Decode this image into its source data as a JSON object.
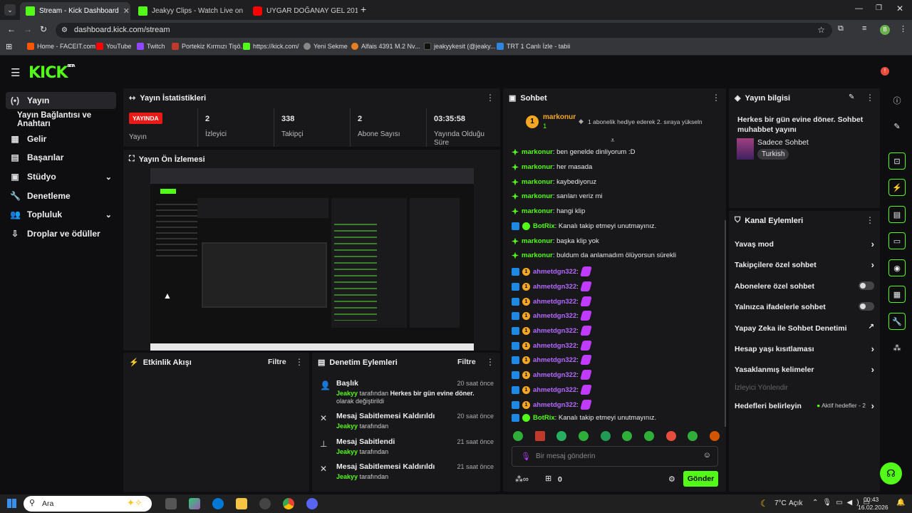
{
  "browser": {
    "tabs": [
      {
        "label": "Stream - Kick Dashboard",
        "color": "#53fc18"
      },
      {
        "label": "Jeakyy Clips - Watch Live on Kic",
        "color": "#53fc18"
      },
      {
        "label": "UYGAR DOĞANAY GEL 201",
        "color": "#ff0000"
      }
    ],
    "new_tab": "+",
    "url": "dashboard.kick.com/stream",
    "bookmarks": [
      "Home - FACEIT.com",
      "YouTube",
      "Twitch",
      "Portekiz Kırmızı Tişö...",
      "https://kick.com/",
      "Yeni Sekme",
      "Alfais 4391 M.2 Nv...",
      "jeakyykesit (@jeaky...",
      "TRT 1 Canlı İzle - tabii"
    ],
    "profile": "B"
  },
  "app": {
    "logo": "KICK",
    "logo_sup": "BETA",
    "accent": "#53fc18"
  },
  "sidebar": {
    "items": [
      {
        "label": "Yayın",
        "icon": "(•)"
      },
      {
        "label": "Yayın Bağlantısı ve Anahtarı",
        "icon": ""
      },
      {
        "label": "Gelir",
        "icon": "▦"
      },
      {
        "label": "Başarılar",
        "icon": "▤"
      },
      {
        "label": "Stüdyo",
        "icon": "▣"
      },
      {
        "label": "Denetleme",
        "icon": "🔧"
      },
      {
        "label": "Topluluk",
        "icon": "👥"
      },
      {
        "label": "Droplar ve ödüller",
        "icon": "⇩"
      }
    ]
  },
  "stats": {
    "title": "Yayın İstatistikleri",
    "live_badge": "YAYINDA",
    "live_label": "Yayın",
    "items": [
      {
        "value": "2",
        "label": "İzleyici"
      },
      {
        "value": "338",
        "label": "Takipçi"
      },
      {
        "value": "2",
        "label": "Abone Sayısı"
      },
      {
        "value": "03:35:58",
        "label": "Yayında Olduğu Süre"
      }
    ]
  },
  "preview": {
    "title": "Yayın Ön İzlemesi"
  },
  "activity": {
    "title": "Etkinlik Akışı",
    "filter": "Filtre"
  },
  "moderation": {
    "title": "Denetim Eylemleri",
    "filter": "Filtre",
    "items": [
      {
        "title": "Başlık",
        "time": "20 saat önce",
        "user": "Jeakyy",
        "by": "tarafından",
        "bold": "Herkes bir gün evine döner.",
        "rest": "olarak değiştirildi"
      },
      {
        "title": "Mesaj Sabitlemesi Kaldırıldı",
        "time": "20 saat önce",
        "user": "Jeakyy",
        "by": "tarafından"
      },
      {
        "title": "Mesaj Sabitlendi",
        "time": "21 saat önce",
        "user": "Jeakyy",
        "by": "tarafından"
      },
      {
        "title": "Mesaj Sabitlemesi Kaldırıldı",
        "time": "21 saat önce",
        "user": "Jeakyy",
        "by": "tarafından"
      }
    ]
  },
  "chat": {
    "title": "Sohbet",
    "pinned_user": "markonur",
    "pinned_count": "1",
    "pinned_rank": "1",
    "pinned_msg": "1 abonelik hediye ederek 2. sıraya yükseln",
    "messages": [
      {
        "user": "markonur",
        "text": ": ben genelde dinliyorum :D",
        "type": "mk"
      },
      {
        "user": "markonur",
        "text": ": her masada",
        "type": "mk"
      },
      {
        "user": "markonur",
        "text": ": kaybediyoruz",
        "type": "mk"
      },
      {
        "user": "markonur",
        "text": ": sarıları veriz mi",
        "type": "mk"
      },
      {
        "user": "markonur",
        "text": ": hangi klip",
        "type": "mk"
      },
      {
        "user": "BotRix",
        "text": ": Kanalı takip etmeyi unutmayınız.",
        "type": "bot"
      },
      {
        "user": "markonur",
        "text": ": başka klip yok",
        "type": "mk"
      },
      {
        "user": "markonur",
        "text": ": buldum da anlamadım ölüyorsun sürekli",
        "type": "mk"
      },
      {
        "user": "ahmetdgn322",
        "text": ":",
        "type": "ah"
      },
      {
        "user": "ahmetdgn322",
        "text": ":",
        "type": "ah"
      },
      {
        "user": "ahmetdgn322",
        "text": ":",
        "type": "ah"
      },
      {
        "user": "ahmetdgn322",
        "text": ":",
        "type": "ah"
      },
      {
        "user": "ahmetdgn322",
        "text": ":",
        "type": "ah"
      },
      {
        "user": "ahmetdgn322",
        "text": ":",
        "type": "ah"
      },
      {
        "user": "ahmetdgn322",
        "text": ":",
        "type": "ah"
      },
      {
        "user": "ahmetdgn322",
        "text": ":",
        "type": "ah"
      },
      {
        "user": "ahmetdgn322",
        "text": ":",
        "type": "ah"
      },
      {
        "user": "ahmetdgn322",
        "text": ":",
        "type": "ah"
      },
      {
        "user": "BotRix",
        "text": ": Kanalı takip etmeyi unutmayınız.",
        "type": "bot"
      }
    ],
    "placeholder": "Bir mesaj gönderin",
    "points": "0",
    "send": "Gönder"
  },
  "info": {
    "title": "Yayın bilgisi",
    "stream_title": "Herkes bir gün evine döner. Sohbet muhabbet yayını",
    "category": "Sadece Sohbet",
    "tag": "Turkish"
  },
  "channel": {
    "title": "Kanal Eylemleri",
    "items": [
      {
        "label": "Yavaş mod",
        "ctrl": "chev"
      },
      {
        "label": "Takipçilere özel sohbet",
        "ctrl": "chev"
      },
      {
        "label": "Abonelere özel sohbet",
        "ctrl": "toggle"
      },
      {
        "label": "Yalnızca ifadelerle sohbet",
        "ctrl": "toggle"
      },
      {
        "label": "Yapay Zeka ile Sohbet Denetimi",
        "ctrl": "ext"
      },
      {
        "label": "Hesap yaşı kısıtlaması",
        "ctrl": "chev"
      },
      {
        "label": "Yasaklanmış kelimeler",
        "ctrl": "chev"
      },
      {
        "label": "İzleyici Yönlendir",
        "ctrl": "none"
      },
      {
        "label": "Hedefleri belirleyin",
        "ctrl": "chev"
      }
    ],
    "goal_status": "Aktif hedefler - 2"
  },
  "taskbar": {
    "search": "Ara",
    "weather": "7°C",
    "weather_desc": "Açık",
    "time": "00:43",
    "date": "16.02.2026"
  }
}
